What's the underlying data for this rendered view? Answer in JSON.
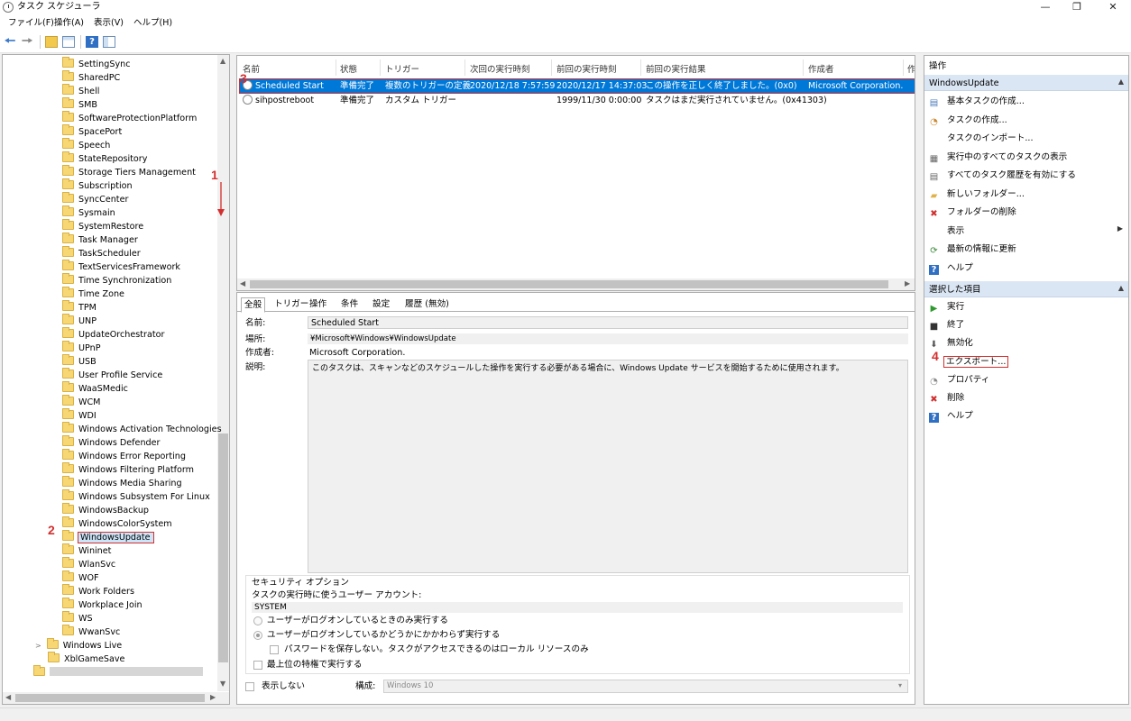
{
  "window": {
    "title": "タスク スケジューラ",
    "min": "—",
    "max": "❐",
    "close": "✕"
  },
  "menu": [
    "ファイル(F)",
    "操作(A)",
    "表示(V)",
    "ヘルプ(H)"
  ],
  "tree": {
    "items": [
      "SettingSync",
      "SharedPC",
      "Shell",
      "SMB",
      "SoftwareProtectionPlatform",
      "SpacePort",
      "Speech",
      "StateRepository",
      "Storage Tiers Management",
      "Subscription",
      "SyncCenter",
      "Sysmain",
      "SystemRestore",
      "Task Manager",
      "TaskScheduler",
      "TextServicesFramework",
      "Time Synchronization",
      "Time Zone",
      "TPM",
      "UNP",
      "UpdateOrchestrator",
      "UPnP",
      "USB",
      "User Profile Service",
      "WaaSMedic",
      "WCM",
      "WDI",
      "Windows Activation Technologies",
      "Windows Defender",
      "Windows Error Reporting",
      "Windows Filtering Platform",
      "Windows Media Sharing",
      "Windows Subsystem For Linux",
      "WindowsBackup",
      "WindowsColorSystem",
      "WindowsUpdate",
      "Wininet",
      "WlanSvc",
      "WOF",
      "Work Folders",
      "Workplace Join",
      "WS",
      "WwanSvc"
    ],
    "selected": "WindowsUpdate",
    "windows_live": "Windows Live",
    "xbl": "XblGameSave"
  },
  "task_list": {
    "columns": [
      "名前",
      "状態",
      "トリガー",
      "次回の実行時刻",
      "前回の実行時刻",
      "前回の実行結果",
      "作成者",
      "作"
    ],
    "rows": [
      [
        "Scheduled Start",
        "準備完了",
        "複数のトリガーの定義",
        "2020/12/18 7:57:59",
        "2020/12/17 14:37:03",
        "この操作を正しく終了しました。(0x0)",
        "Microsoft Corporation."
      ],
      [
        "sihpostreboot",
        "準備完了",
        "カスタム トリガー",
        "",
        "1999/11/30 0:00:00",
        "タスクはまだ実行されていません。(0x41303)",
        ""
      ]
    ]
  },
  "detail": {
    "tabs": [
      "全般",
      "トリガー",
      "操作",
      "条件",
      "設定",
      "履歴 (無効)"
    ],
    "name_label": "名前:",
    "name_value": "Scheduled Start",
    "location_label": "場所:",
    "location_value": "¥Microsoft¥Windows¥WindowsUpdate",
    "author_label": "作成者:",
    "author_value": "Microsoft Corporation.",
    "desc_label": "説明:",
    "desc_value": "このタスクは、スキャンなどのスケジュールした操作を実行する必要がある場合に、Windows Update サービスを開始するために使用されます。",
    "security_title": "セキュリティ オプション",
    "account_label": "タスクの実行時に使うユーザー アカウント:",
    "account_value": "SYSTEM",
    "radio1": "ユーザーがログオンしているときのみ実行する",
    "radio2": "ユーザーがログオンしているかどうかにかかわらず実行する",
    "nopass": "パスワードを保存しない。タスクがアクセスできるのはローカル リソースのみ",
    "highest": "最上位の特権で実行する",
    "hidden": "表示しない",
    "config_label": "構成:",
    "config_value": "Windows 10"
  },
  "actions": {
    "header": "操作",
    "group1": "WindowsUpdate",
    "items1": [
      "基本タスクの作成...",
      "タスクの作成...",
      "タスクのインポート...",
      "実行中のすべてのタスクの表示",
      "すべてのタスク履歴を有効にする",
      "新しいフォルダー...",
      "フォルダーの削除",
      "表示",
      "最新の情報に更新",
      "ヘルプ"
    ],
    "group2": "選択した項目",
    "items2": [
      "実行",
      "終了",
      "無効化",
      "エクスポート...",
      "プロパティ",
      "削除",
      "ヘルプ"
    ]
  },
  "annotations": [
    "1",
    "2",
    "3",
    "4"
  ],
  "colors": {
    "selection": "#0078d7",
    "annotation": "#d32f2f",
    "action_header": "#dbe6f4"
  }
}
